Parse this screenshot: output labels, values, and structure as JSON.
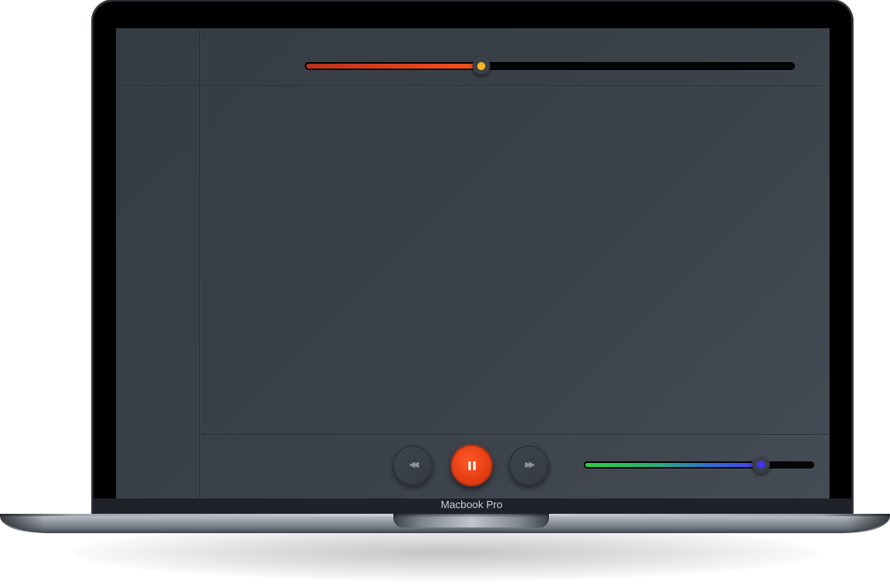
{
  "device": {
    "model_label": "Macbook Pro"
  },
  "player": {
    "progress": 0.36,
    "volume": 0.77,
    "controls": {
      "prev_icon": "rewind-icon",
      "play_icon": "pause-icon",
      "next_icon": "fast-forward-icon"
    },
    "colors": {
      "accent": "#e23c12",
      "progress_thumb_dot": "#f2b52a",
      "volume_thumb_dot": "#3f37e8",
      "volume_gradient_start": "#2ed140",
      "volume_gradient_end": "#4a3cf0"
    }
  }
}
